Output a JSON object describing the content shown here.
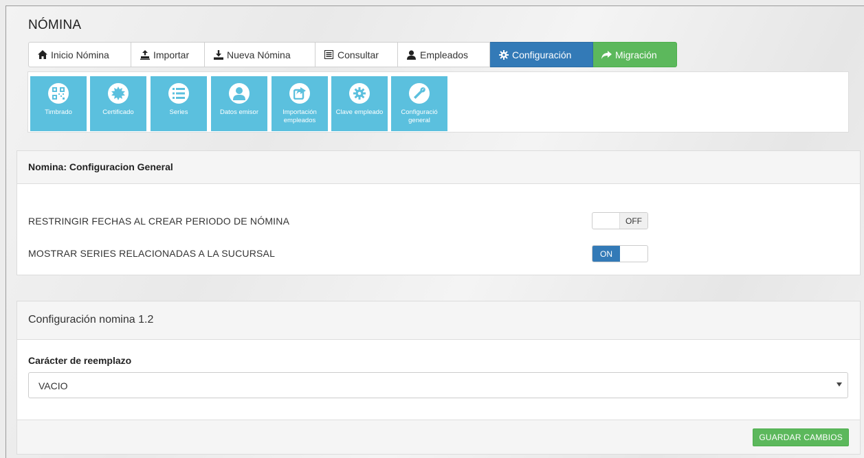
{
  "page": {
    "title": "NÓMINA"
  },
  "tabs": [
    {
      "label": "Inicio Nómina",
      "icon": "home-icon"
    },
    {
      "label": "Importar",
      "icon": "import-icon"
    },
    {
      "label": "Nueva Nómina",
      "icon": "download-icon"
    },
    {
      "label": "Consultar",
      "icon": "list-alt-icon"
    },
    {
      "label": "Empleados",
      "icon": "user-icon"
    },
    {
      "label": "Configuración",
      "icon": "gear-icon",
      "active": true
    },
    {
      "label": "Migración",
      "icon": "share-arrow-icon"
    }
  ],
  "tiles": [
    {
      "label": "Timbrado",
      "icon": "qrcode-icon"
    },
    {
      "label": "Certificado",
      "icon": "certificate-icon"
    },
    {
      "label": "Series",
      "icon": "list-icon"
    },
    {
      "label": "Datos emisor",
      "icon": "user-icon"
    },
    {
      "label": "Importación empleados",
      "icon": "share-icon"
    },
    {
      "label": "Clave empleado",
      "icon": "gear-icon"
    },
    {
      "label": "Configuració general",
      "icon": "wrench-icon"
    }
  ],
  "general_config": {
    "title": "Nomina: Configuracion General",
    "options": [
      {
        "label": "RESTRINGIR FECHAS AL CREAR PERIODO DE NÓMINA",
        "state": "OFF"
      },
      {
        "label": "MOSTRAR SERIES RELACIONADAS A LA SUCURSAL",
        "state": "ON"
      }
    ]
  },
  "config_12": {
    "title": "Configuración nomina 1.2",
    "field_label": "Carácter de reemplazo",
    "select_value": "VACIO",
    "save_label": "GUARDAR CAMBIOS"
  },
  "colors": {
    "primary": "#337ab7",
    "success": "#5cb85c",
    "info": "#5bc0de"
  }
}
